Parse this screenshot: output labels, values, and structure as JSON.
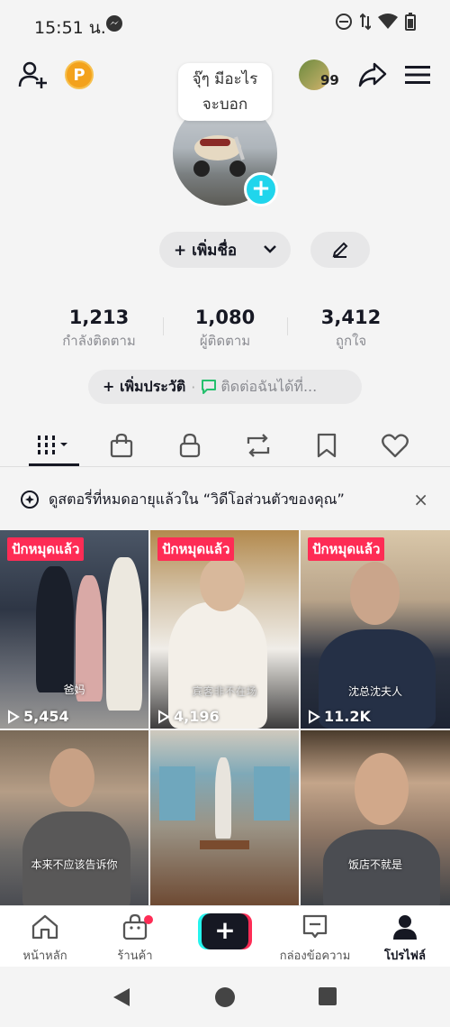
{
  "status": {
    "time": "15:51 น."
  },
  "profile": {
    "bubble_line1": "จุ๊ๆ มีอะไร",
    "bubble_line2": "จะบอก",
    "add_name_label": "+ เพิ่มชื่อ",
    "add_bio_label": "+ เพิ่มประวัติ",
    "contact_label": "ติดต่อฉันได้ที่...",
    "friend_badge_count": "99"
  },
  "stats": [
    {
      "value": "1,213",
      "label": "กำลังติดตาม"
    },
    {
      "value": "1,080",
      "label": "ผู้ติดตาม"
    },
    {
      "value": "3,412",
      "label": "ถูกใจ"
    }
  ],
  "tabs": [
    {
      "icon": "grid-icon",
      "active": true
    },
    {
      "icon": "shopping-bag-icon"
    },
    {
      "icon": "lock-icon"
    },
    {
      "icon": "repost-icon"
    },
    {
      "icon": "bookmark-icon"
    },
    {
      "icon": "heart-icon"
    }
  ],
  "banner": {
    "text": "ดูสตอรี่ที่หมดอายุแล้วใน “วิดีโอส่วนตัวของคุณ”",
    "close": "×"
  },
  "videos": [
    {
      "pinned": "ปักหมุดแล้ว",
      "plays": "5,454",
      "caption": "爸妈"
    },
    {
      "pinned": "ปักหมุดแล้ว",
      "plays": "4,196",
      "caption": "宾客非不在场"
    },
    {
      "pinned": "ปักหมุดแล้ว",
      "plays": "11.2K",
      "caption": "沈总沈夫人"
    },
    {
      "caption": "本来不应该告诉你"
    },
    {
      "caption": ""
    },
    {
      "caption": "饭店不就是"
    }
  ],
  "bottom_nav": {
    "home": "หน้าหลัก",
    "shop": "ร้านค้า",
    "create": "+",
    "inbox": "กล่องข้อความ",
    "profile": "โปรไฟล์"
  },
  "colors": {
    "accent_pink": "#fe2c55",
    "accent_cyan": "#25f4ee",
    "plus_badge": "#20d5ec",
    "coin": "#f3a21c"
  }
}
